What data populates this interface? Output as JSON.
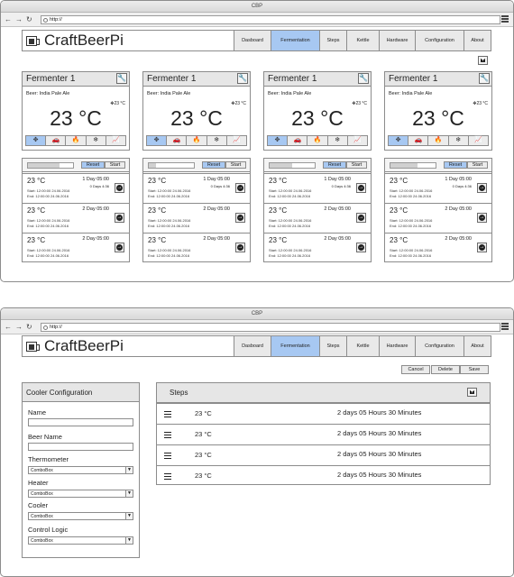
{
  "window": {
    "title": "CBP",
    "url": "http://"
  },
  "brand": "CraftBeerPi",
  "nav": [
    "Dasboard",
    "Fermentation",
    "Steps",
    "Kettle",
    "Hardware",
    "Configuration",
    "About"
  ],
  "nav_active": "Fermentation",
  "icons": {
    "back": "back-arrow-icon",
    "forward": "forward-arrow-icon",
    "reload": "reload-icon",
    "menu": "hamburger-menu-icon",
    "settings": "wrench-icon",
    "add": "plus-icon",
    "go": "arrow-right-circle-icon",
    "controls": [
      "crosshair-icon",
      "car-icon",
      "flame-icon",
      "snowflake-icon",
      "chart-icon"
    ]
  },
  "colors": {
    "accent": "#a7c8f2"
  },
  "fermenters": [
    {
      "name": "Fermenter 1",
      "beer": "Beer: India Pale Ale",
      "temp": "23 °C",
      "target": "23 °C",
      "progress": 0.7,
      "reset_label": "Reset",
      "start_label": "Start",
      "steps": [
        {
          "temp": "23 °C",
          "duration": "1 Day 05:00",
          "remaining": "0 Days 4:36",
          "start": "Start: 12:00:00 24.06.2016",
          "end": "End: 12:00:00 24.06.2016"
        },
        {
          "temp": "23 °C",
          "duration": "2 Day 05:00",
          "remaining": "",
          "start": "Start: 12:00:00 24.06.2016",
          "end": "End: 12:00:00 24.06.2016"
        },
        {
          "temp": "23 °C",
          "duration": "2 Day 05:00",
          "remaining": "",
          "start": "Start: 12:00:00 24.06.2016",
          "end": "End: 12:00:00 24.06.2016"
        }
      ]
    },
    {
      "name": "Fermenter 1",
      "beer": "Beer: India Pale Ale",
      "temp": "23 °C",
      "target": "23 °C",
      "progress": 0.15,
      "reset_label": "Reset",
      "start_label": "Start",
      "steps": [
        {
          "temp": "23 °C",
          "duration": "1 Day 05:00",
          "remaining": "0 Days 4:36",
          "start": "Start: 12:00:00 24.06.2016",
          "end": "End: 12:00:00 24.06.2016"
        },
        {
          "temp": "23 °C",
          "duration": "2 Day 05:00",
          "remaining": "",
          "start": "Start: 12:00:00 24.06.2016",
          "end": "End: 12:00:00 24.06.2016"
        },
        {
          "temp": "23 °C",
          "duration": "2 Day 05:00",
          "remaining": "",
          "start": "Start: 12:00:00 24.06.2016",
          "end": "End: 12:00:00 24.06.2016"
        }
      ]
    },
    {
      "name": "Fermenter 1",
      "beer": "Beer: India Pale Ale",
      "temp": "23 °C",
      "target": "23 °C",
      "progress": 0.5,
      "reset_label": "Reset",
      "start_label": "Start",
      "steps": [
        {
          "temp": "23 °C",
          "duration": "1 Day 05:00",
          "remaining": "0 Days 4:36",
          "start": "Start: 12:00:00 24.06.2016",
          "end": "End: 12:00:00 24.06.2016"
        },
        {
          "temp": "23 °C",
          "duration": "2 Day 05:00",
          "remaining": "",
          "start": "Start: 12:00:00 24.06.2016",
          "end": "End: 12:00:00 24.06.2016"
        },
        {
          "temp": "23 °C",
          "duration": "2 Day 05:00",
          "remaining": "",
          "start": "Start: 12:00:00 24.06.2016",
          "end": "End: 12:00:00 24.06.2016"
        }
      ]
    },
    {
      "name": "Fermenter 1",
      "beer": "Beer: India Pale Ale",
      "temp": "23 °C",
      "target": "23 °C",
      "progress": 0.6,
      "reset_label": "Reset",
      "start_label": "Start",
      "steps": [
        {
          "temp": "23 °C",
          "duration": "1 Day 05:00",
          "remaining": "0 Days 4:36",
          "start": "Start: 12:00:00 24.06.2016",
          "end": "End: 12:00:00 24.06.2016"
        },
        {
          "temp": "23 °C",
          "duration": "2 Day 05:00",
          "remaining": "",
          "start": "Start: 12:00:00 24.06.2016",
          "end": "End: 12:00:00 24.06.2016"
        },
        {
          "temp": "23 °C",
          "duration": "2 Day 05:00",
          "remaining": "",
          "start": "Start: 12:00:00 24.06.2016",
          "end": "End: 12:00:00 24.06.2016"
        }
      ]
    }
  ],
  "actions": {
    "cancel": "Cancel",
    "delete": "Delete",
    "save": "Save"
  },
  "cooler": {
    "title": "Cooler Configuration",
    "fields": [
      {
        "label": "Name",
        "type": "text",
        "value": ""
      },
      {
        "label": "Beer Name",
        "type": "text",
        "value": ""
      },
      {
        "label": "Thermometer",
        "type": "combo",
        "value": "ComboBox"
      },
      {
        "label": "Heater",
        "type": "combo",
        "value": "ComboBox"
      },
      {
        "label": "Cooler",
        "type": "combo",
        "value": "ComboBox"
      },
      {
        "label": "Control Logic",
        "type": "combo",
        "value": "ComboBox"
      }
    ]
  },
  "steps_panel": {
    "title": "Steps",
    "rows": [
      {
        "temp": "23 °C",
        "duration": "2 days 05 Hours 30 Minutes"
      },
      {
        "temp": "23 °C",
        "duration": "2 days 05 Hours 30 Minutes"
      },
      {
        "temp": "23 °C",
        "duration": "2 days 05 Hours 30 Minutes"
      },
      {
        "temp": "23 °C",
        "duration": "2 days 05 Hours 30 Minutes"
      }
    ]
  }
}
